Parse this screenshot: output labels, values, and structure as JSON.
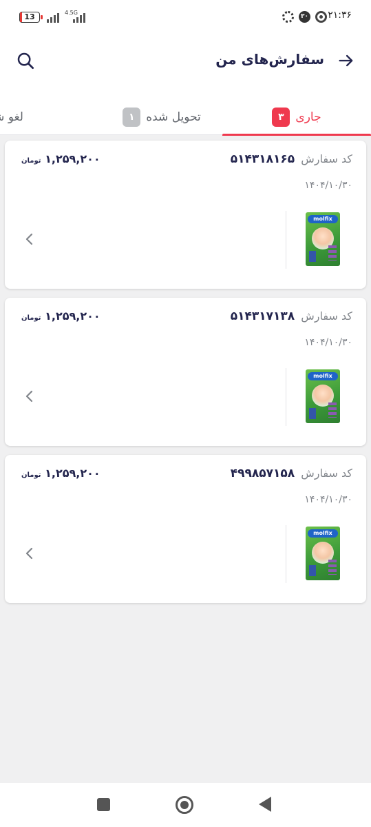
{
  "status_bar": {
    "time": "۲۱:۳۶",
    "battery": "13",
    "network": "4.5G",
    "notification_count": "۳۰"
  },
  "header": {
    "title": "سفارش‌های من"
  },
  "tabs": [
    {
      "label": "جاری",
      "count": "۳"
    },
    {
      "label": "تحویل شده",
      "count": "۱"
    },
    {
      "label": "لغو شده"
    }
  ],
  "order_code_label": "کد سفارش",
  "currency": "تومان",
  "orders": [
    {
      "code": "۵۱۴۳۱۸۱۶۵",
      "price": "۱,۲۵۹,۲۰۰",
      "date": "۱۴۰۴/۱۰/۳۰",
      "product_brand": "molfix"
    },
    {
      "code": "۵۱۴۳۱۷۱۳۸",
      "price": "۱,۲۵۹,۲۰۰",
      "date": "۱۴۰۴/۱۰/۳۰",
      "product_brand": "molfix"
    },
    {
      "code": "۴۹۹۸۵۷۱۵۸",
      "price": "۱,۲۵۹,۲۰۰",
      "date": "۱۴۰۴/۱۰/۳۰",
      "product_brand": "molfix"
    }
  ],
  "colors": {
    "accent": "#ef394e",
    "badge_gray": "#c0c2c5",
    "background": "#f0f0f1"
  }
}
